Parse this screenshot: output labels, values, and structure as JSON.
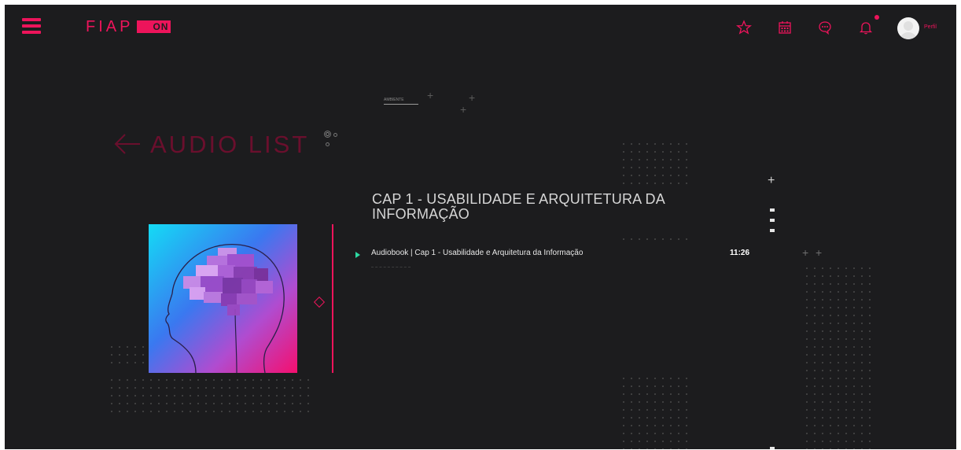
{
  "header": {
    "menu_icon": "hamburger-menu-icon",
    "logo": {
      "brand": "FIAP",
      "suffix": "ON"
    },
    "icons": [
      "star-icon",
      "calendar-icon",
      "chat-icon",
      "bell-icon"
    ],
    "profile_label": "Perfil"
  },
  "slider": {
    "label": "AMBIENTE"
  },
  "page": {
    "title": "AUDIO LIST",
    "back_icon": "arrow-left-icon"
  },
  "chapter": {
    "title": "CAP 1 - USABILIDADE E ARQUITETURA DA INFORMAÇÃO"
  },
  "tracks": [
    {
      "title": "Audiobook | Cap 1 - Usabilidade e Arquitetura da Informação",
      "duration": "11:26"
    }
  ],
  "colors": {
    "accent": "#ed145b",
    "background": "#1c1c1e",
    "play": "#2dd9a2"
  }
}
